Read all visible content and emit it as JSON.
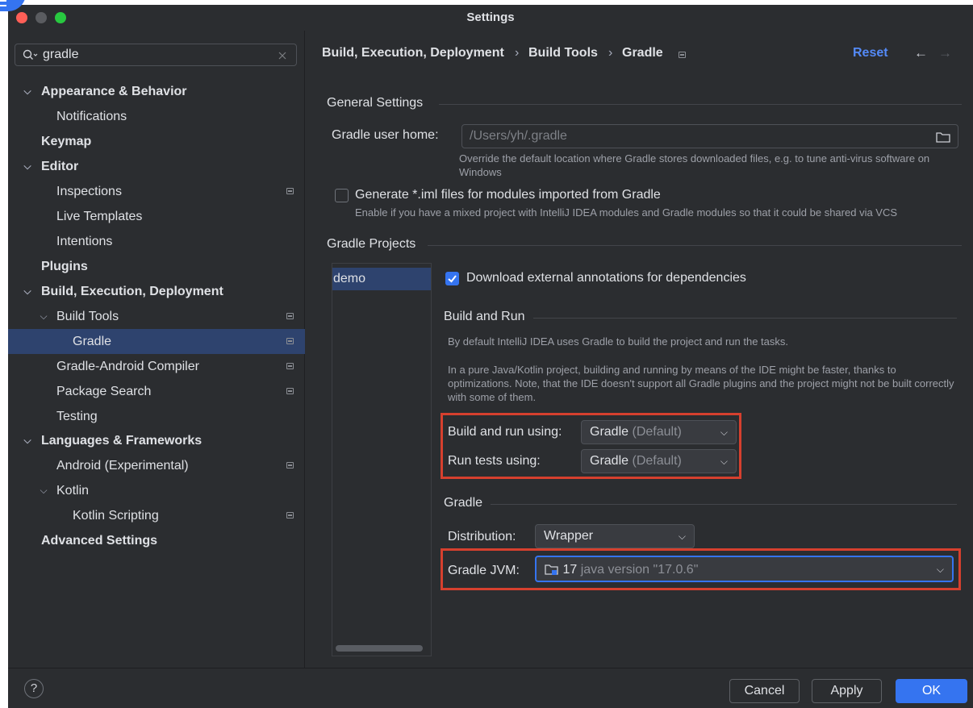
{
  "window": {
    "title": "Settings"
  },
  "colors": {
    "accent": "#3574f0",
    "selection": "#2e436e",
    "highlight_box": "#d6402e",
    "close": "#ff5f57",
    "minimize": "#febc2e",
    "maximize": "#28c840"
  },
  "search": {
    "value": "gradle",
    "icon": "search-icon",
    "clear_icon": "close-icon"
  },
  "sidebar": {
    "items": [
      {
        "label": "Appearance & Behavior"
      },
      {
        "label": "Notifications"
      },
      {
        "label": "Keymap"
      },
      {
        "label": "Editor"
      },
      {
        "label": "Inspections"
      },
      {
        "label": "Live Templates"
      },
      {
        "label": "Intentions"
      },
      {
        "label": "Plugins"
      },
      {
        "label": "Build, Execution, Deployment"
      },
      {
        "label": "Build Tools"
      },
      {
        "label": "Gradle"
      },
      {
        "label": "Gradle-Android Compiler"
      },
      {
        "label": "Package Search"
      },
      {
        "label": "Testing"
      },
      {
        "label": "Languages & Frameworks"
      },
      {
        "label": "Android (Experimental)"
      },
      {
        "label": "Kotlin"
      },
      {
        "label": "Kotlin Scripting"
      },
      {
        "label": "Advanced Settings"
      }
    ]
  },
  "breadcrumb": {
    "items": [
      "Build, Execution, Deployment",
      "Build Tools",
      "Gradle"
    ],
    "separator": "›",
    "reset": "Reset",
    "back": "←",
    "forward": "→"
  },
  "general": {
    "title": "General Settings",
    "user_home_label": "Gradle user home:",
    "user_home_placeholder": "/Users/yh/.gradle",
    "user_home_hint": "Override the default location where Gradle stores downloaded files, e.g. to tune anti-virus software on Windows",
    "iml_label": "Generate *.iml files for modules imported from Gradle",
    "iml_hint": "Enable if you have a mixed project with IntelliJ IDEA modules and Gradle modules so that it could be shared via VCS",
    "iml_checked": false
  },
  "projects": {
    "title": "Gradle Projects",
    "list": [
      "demo"
    ],
    "download_annotations_label": "Download external annotations for dependencies",
    "download_annotations_checked": true
  },
  "build_and_run": {
    "title": "Build and Run",
    "desc1": "By default IntelliJ IDEA uses Gradle to build the project and run the tasks.",
    "desc2": "In a pure Java/Kotlin project, building and running by means of the IDE might be faster, thanks to optimizations. Note, that the IDE doesn't support all Gradle plugins and the project might not be built correctly with some of them.",
    "build_label": "Build and run using:",
    "build_value": "Gradle",
    "build_suffix": "(Default)",
    "tests_label": "Run tests using:",
    "tests_value": "Gradle",
    "tests_suffix": "(Default)"
  },
  "gradle": {
    "title": "Gradle",
    "distribution_label": "Distribution:",
    "distribution_value": "Wrapper",
    "jvm_label": "Gradle JVM:",
    "jvm_version": "17",
    "jvm_detail": "java version \"17.0.6\""
  },
  "footer": {
    "help": "?",
    "cancel": "Cancel",
    "apply": "Apply",
    "ok": "OK"
  }
}
